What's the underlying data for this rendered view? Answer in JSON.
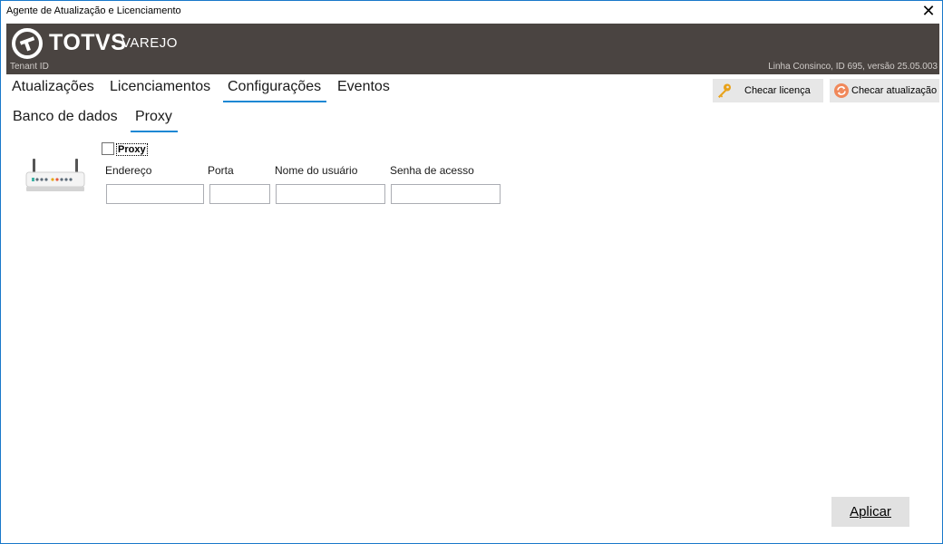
{
  "window": {
    "title": "Agente de Atualização e Licenciamento",
    "close_glyph": "✕"
  },
  "banner": {
    "brand": "TOTVS",
    "product": "VAREJO",
    "tenant_label": "Tenant ID",
    "version_info": "Linha Consinco, ID 695, versão 25.05.003",
    "background": "#4a4441"
  },
  "main_tabs": [
    {
      "label": "Atualizações",
      "active": false
    },
    {
      "label": "Licenciamentos",
      "active": false
    },
    {
      "label": "Configurações",
      "active": true
    },
    {
      "label": "Eventos",
      "active": false
    }
  ],
  "sub_tabs": [
    {
      "label": "Banco de dados",
      "active": false
    },
    {
      "label": "Proxy",
      "active": true
    }
  ],
  "actions": {
    "check_license": {
      "label": "Checar licença",
      "icon": "key-icon"
    },
    "check_update": {
      "label": "Checar atualização",
      "icon": "refresh-icon"
    }
  },
  "proxy": {
    "enabled_label": "Proxy",
    "enabled": false,
    "icon": "router-icon",
    "fields": {
      "address": {
        "label": "Endereço",
        "value": ""
      },
      "port": {
        "label": "Porta",
        "value": ""
      },
      "username": {
        "label": "Nome do usuário",
        "value": ""
      },
      "password": {
        "label": "Senha de acesso",
        "value": ""
      }
    }
  },
  "footer": {
    "apply_label": "Aplicar"
  },
  "colors": {
    "accent": "#1e88d4",
    "window_border": "#1979ca"
  }
}
